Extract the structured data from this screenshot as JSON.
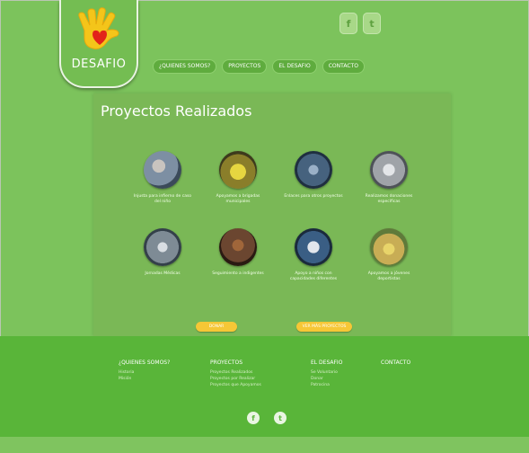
{
  "header": {
    "logo_text": "DESAFIO",
    "social": [
      {
        "icon": "facebook-icon",
        "glyph": "f"
      },
      {
        "icon": "twitter-icon",
        "glyph": "t"
      }
    ],
    "nav": [
      {
        "label": "¿QUIENES SOMOS?"
      },
      {
        "label": "PROYECTOS"
      },
      {
        "label": "EL DESAFIO"
      },
      {
        "label": "CONTACTO"
      }
    ]
  },
  "main": {
    "title": "Proyectos Realizados",
    "projects": [
      {
        "caption": "Injusta para infierno de caso del niño",
        "color": "#7d8fa3"
      },
      {
        "caption": "Apoyamos a brigadas municipales",
        "color": "#b7a83a"
      },
      {
        "caption": "Enlaces para otros proyectos",
        "color": "#46627e"
      },
      {
        "caption": "Realizamos donaciones específicas",
        "color": "#9fa3a8"
      },
      {
        "caption": "Jornadas Médicas",
        "color": "#7e8b95"
      },
      {
        "caption": "Seguimiento a indigentes",
        "color": "#6b4630"
      },
      {
        "caption": "Apoyo a niños con capacidades diferentes",
        "color": "#3a5e84"
      },
      {
        "caption": "Apoyamos a jóvenes deportistas",
        "color": "#c8ad55"
      }
    ],
    "buttons": [
      {
        "label": "DONAR"
      },
      {
        "label": "VER MÁS PROYECTOS"
      }
    ]
  },
  "footer": {
    "columns": [
      {
        "heading": "¿QUIENES SOMOS?",
        "items": [
          "Historia",
          "Misión"
        ]
      },
      {
        "heading": "PROYECTOS",
        "items": [
          "Proyectos Realizados",
          "Proyectos por Realizar",
          "Proyectos que Apoyamos"
        ]
      },
      {
        "heading": "EL DESAFIO",
        "items": [
          "Se Voluntario",
          "Donar",
          "Patrocina"
        ]
      },
      {
        "heading": "CONTACTO",
        "items": []
      }
    ],
    "social": [
      {
        "icon": "facebook-icon",
        "glyph": "f"
      },
      {
        "icon": "twitter-icon",
        "glyph": "t"
      }
    ]
  }
}
